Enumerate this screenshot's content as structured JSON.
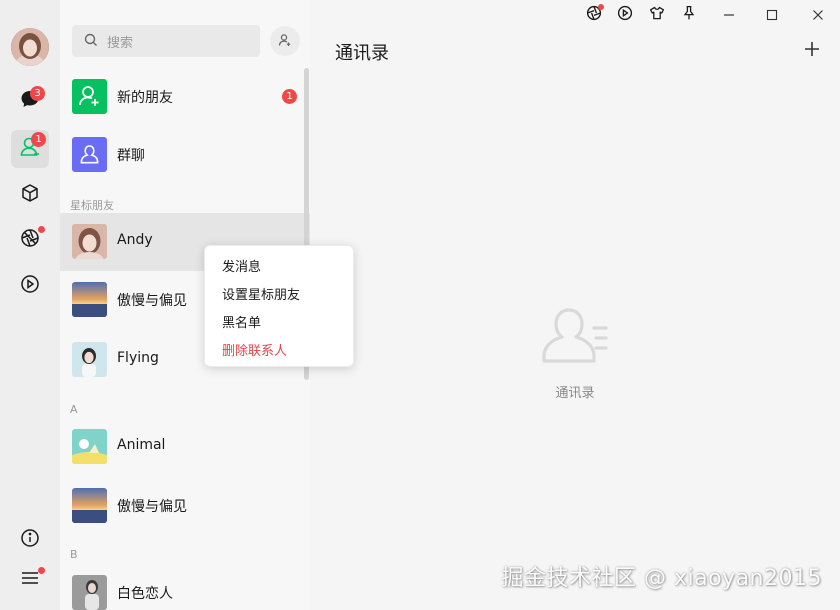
{
  "nav": {
    "chat_badge": "3",
    "contacts_badge": "1"
  },
  "search": {
    "placeholder": "搜索"
  },
  "contacts": {
    "new_friends": {
      "label": "新的朋友",
      "badge": "1"
    },
    "group_chat": {
      "label": "群聊"
    },
    "sections": [
      "星标朋友",
      "A",
      "B"
    ],
    "starred": [
      {
        "name": "Andy"
      },
      {
        "name": "傲慢与偏见"
      },
      {
        "name": "Flying"
      }
    ],
    "a_group": [
      {
        "name": "Animal"
      },
      {
        "name": "傲慢与偏见"
      }
    ],
    "b_group": [
      {
        "name": "白色恋人"
      }
    ]
  },
  "context_menu": {
    "items": [
      "发消息",
      "设置星标朋友",
      "黑名单",
      "删除联系人"
    ]
  },
  "main": {
    "title": "通讯录",
    "empty_label": "通讯录"
  },
  "watermark": "掘金技术社区 @ xiaoyan2015",
  "colors": {
    "accent_green": "#07c160",
    "group_purple": "#6b6cf6",
    "badge_red": "#f0484a",
    "danger_text": "#e0464a"
  }
}
